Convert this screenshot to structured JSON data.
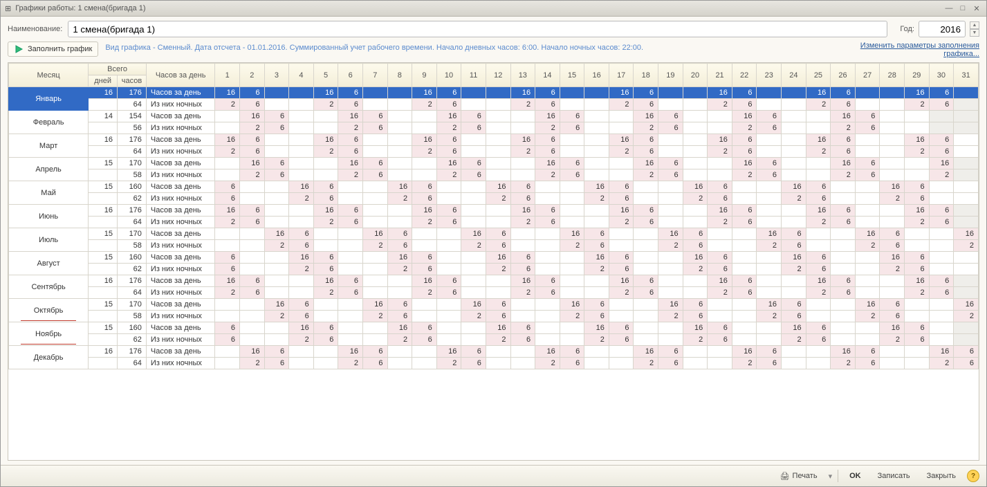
{
  "window_title": "Графики работы: 1 смена(бригада 1)",
  "labels": {
    "name": "Наименование:",
    "year": "Год:",
    "fill": "Заполнить график",
    "info": "Вид графика - Сменный. Дата отсчета - 01.01.2016. Суммированный учет рабочего времени. Начало дневных часов: 6:00. Начало ночных часов: 22:00.",
    "change": "Изменить параметры заполнения\nграфика...",
    "print": "Печать",
    "ok": "OK",
    "save": "Записать",
    "close": "Закрыть"
  },
  "fields": {
    "name_value": "1 смена(бригада 1)",
    "year_value": "2016"
  },
  "headers": {
    "month": "Месяц",
    "total": "Всего",
    "days": "дней",
    "hours": "часов",
    "perday": "Часов за день",
    "row_h": "Часов за день",
    "row_n": "Из них ночных"
  },
  "underlined_months": [
    "Октябрь",
    "Ноябрь"
  ],
  "months": [
    {
      "name": "Январь",
      "days": 16,
      "hours": 176,
      "night": 64,
      "h": {
        "1": 16,
        "2": 6,
        "5": 16,
        "6": 6,
        "9": 16,
        "10": 6,
        "13": 16,
        "14": 6,
        "17": 16,
        "18": 6,
        "21": 16,
        "22": 6,
        "25": 16,
        "26": 6,
        "29": 16,
        "30": 6
      },
      "n": {
        "1": 2,
        "2": 6,
        "5": 2,
        "6": 6,
        "9": 2,
        "10": 6,
        "13": 2,
        "14": 6,
        "17": 2,
        "18": 6,
        "21": 2,
        "22": 6,
        "25": 2,
        "26": 6,
        "29": 2,
        "30": 6
      },
      "weekend": [
        31
      ]
    },
    {
      "name": "Февраль",
      "days": 14,
      "hours": 154,
      "night": 56,
      "h": {
        "2": 16,
        "3": 6,
        "6": 16,
        "7": 6,
        "10": 16,
        "11": 6,
        "14": 16,
        "15": 6,
        "18": 16,
        "19": 6,
        "22": 16,
        "23": 6,
        "26": 16,
        "27": 6
      },
      "n": {
        "2": 2,
        "3": 6,
        "6": 2,
        "7": 6,
        "10": 2,
        "11": 6,
        "14": 2,
        "15": 6,
        "18": 2,
        "19": 6,
        "22": 2,
        "23": 6,
        "26": 2,
        "27": 6
      },
      "weekend": [
        30,
        31
      ]
    },
    {
      "name": "Март",
      "days": 16,
      "hours": 176,
      "night": 64,
      "h": {
        "1": 16,
        "2": 6,
        "5": 16,
        "6": 6,
        "9": 16,
        "10": 6,
        "13": 16,
        "14": 6,
        "17": 16,
        "18": 6,
        "21": 16,
        "22": 6,
        "25": 16,
        "26": 6,
        "29": 16,
        "30": 6
      },
      "n": {
        "1": 2,
        "2": 6,
        "5": 2,
        "6": 6,
        "9": 2,
        "10": 6,
        "13": 2,
        "14": 6,
        "17": 2,
        "18": 6,
        "21": 2,
        "22": 6,
        "25": 2,
        "26": 6,
        "29": 2,
        "30": 6
      },
      "weekend": []
    },
    {
      "name": "Апрель",
      "days": 15,
      "hours": 170,
      "night": 58,
      "h": {
        "2": 16,
        "3": 6,
        "6": 16,
        "7": 6,
        "10": 16,
        "11": 6,
        "14": 16,
        "15": 6,
        "18": 16,
        "19": 6,
        "22": 16,
        "23": 6,
        "26": 16,
        "27": 6,
        "30": 16
      },
      "n": {
        "2": 2,
        "3": 6,
        "6": 2,
        "7": 6,
        "10": 2,
        "11": 6,
        "14": 2,
        "15": 6,
        "18": 2,
        "19": 6,
        "22": 2,
        "23": 6,
        "26": 2,
        "27": 6,
        "30": 2
      },
      "weekend": [
        31
      ]
    },
    {
      "name": "Май",
      "days": 15,
      "hours": 160,
      "night": 62,
      "h": {
        "1": 6,
        "4": 16,
        "5": 6,
        "8": 16,
        "9": 6,
        "12": 16,
        "13": 6,
        "16": 16,
        "17": 6,
        "20": 16,
        "21": 6,
        "24": 16,
        "25": 6,
        "28": 16,
        "29": 6
      },
      "n": {
        "1": 6,
        "4": 2,
        "5": 6,
        "8": 2,
        "9": 6,
        "12": 2,
        "13": 6,
        "16": 2,
        "17": 6,
        "20": 2,
        "21": 6,
        "24": 2,
        "25": 6,
        "28": 2,
        "29": 6
      },
      "weekend": []
    },
    {
      "name": "Июнь",
      "days": 16,
      "hours": 176,
      "night": 64,
      "h": {
        "1": 16,
        "2": 6,
        "5": 16,
        "6": 6,
        "9": 16,
        "10": 6,
        "13": 16,
        "14": 6,
        "17": 16,
        "18": 6,
        "21": 16,
        "22": 6,
        "25": 16,
        "26": 6,
        "29": 16,
        "30": 6
      },
      "n": {
        "1": 2,
        "2": 6,
        "5": 2,
        "6": 6,
        "9": 2,
        "10": 6,
        "13": 2,
        "14": 6,
        "17": 2,
        "18": 6,
        "21": 2,
        "22": 6,
        "25": 2,
        "26": 6,
        "29": 2,
        "30": 6
      },
      "weekend": [
        31
      ]
    },
    {
      "name": "Июль",
      "days": 15,
      "hours": 170,
      "night": 58,
      "h": {
        "3": 16,
        "4": 6,
        "7": 16,
        "8": 6,
        "11": 16,
        "12": 6,
        "15": 16,
        "16": 6,
        "19": 16,
        "20": 6,
        "23": 16,
        "24": 6,
        "27": 16,
        "28": 6,
        "31": 16
      },
      "n": {
        "3": 2,
        "4": 6,
        "7": 2,
        "8": 6,
        "11": 2,
        "12": 6,
        "15": 2,
        "16": 6,
        "19": 2,
        "20": 6,
        "23": 2,
        "24": 6,
        "27": 2,
        "28": 6,
        "31": 2
      },
      "weekend": []
    },
    {
      "name": "Август",
      "days": 15,
      "hours": 160,
      "night": 62,
      "h": {
        "1": 6,
        "4": 16,
        "5": 6,
        "8": 16,
        "9": 6,
        "12": 16,
        "13": 6,
        "16": 16,
        "17": 6,
        "20": 16,
        "21": 6,
        "24": 16,
        "25": 6,
        "28": 16,
        "29": 6
      },
      "n": {
        "1": 6,
        "4": 2,
        "5": 6,
        "8": 2,
        "9": 6,
        "12": 2,
        "13": 6,
        "16": 2,
        "17": 6,
        "20": 2,
        "21": 6,
        "24": 2,
        "25": 6,
        "28": 2,
        "29": 6
      },
      "weekend": []
    },
    {
      "name": "Сентябрь",
      "days": 16,
      "hours": 176,
      "night": 64,
      "h": {
        "1": 16,
        "2": 6,
        "5": 16,
        "6": 6,
        "9": 16,
        "10": 6,
        "13": 16,
        "14": 6,
        "17": 16,
        "18": 6,
        "21": 16,
        "22": 6,
        "25": 16,
        "26": 6,
        "29": 16,
        "30": 6
      },
      "n": {
        "1": 2,
        "2": 6,
        "5": 2,
        "6": 6,
        "9": 2,
        "10": 6,
        "13": 2,
        "14": 6,
        "17": 2,
        "18": 6,
        "21": 2,
        "22": 6,
        "25": 2,
        "26": 6,
        "29": 2,
        "30": 6
      },
      "weekend": [
        31
      ]
    },
    {
      "name": "Октябрь",
      "days": 15,
      "hours": 170,
      "night": 58,
      "h": {
        "3": 16,
        "4": 6,
        "7": 16,
        "8": 6,
        "11": 16,
        "12": 6,
        "15": 16,
        "16": 6,
        "19": 16,
        "20": 6,
        "23": 16,
        "24": 6,
        "27": 16,
        "28": 6,
        "31": 16
      },
      "n": {
        "3": 2,
        "4": 6,
        "7": 2,
        "8": 6,
        "11": 2,
        "12": 6,
        "15": 2,
        "16": 6,
        "19": 2,
        "20": 6,
        "23": 2,
        "24": 6,
        "27": 2,
        "28": 6,
        "31": 2
      },
      "weekend": []
    },
    {
      "name": "Ноябрь",
      "days": 15,
      "hours": 160,
      "night": 62,
      "h": {
        "1": 6,
        "4": 16,
        "5": 6,
        "8": 16,
        "9": 6,
        "12": 16,
        "13": 6,
        "16": 16,
        "17": 6,
        "20": 16,
        "21": 6,
        "24": 16,
        "25": 6,
        "28": 16,
        "29": 6
      },
      "n": {
        "1": 6,
        "4": 2,
        "5": 6,
        "8": 2,
        "9": 6,
        "12": 2,
        "13": 6,
        "16": 2,
        "17": 6,
        "20": 2,
        "21": 6,
        "24": 2,
        "25": 6,
        "28": 2,
        "29": 6
      },
      "weekend": [
        31
      ]
    },
    {
      "name": "Декабрь",
      "days": 16,
      "hours": 176,
      "night": 64,
      "h": {
        "2": 16,
        "3": 6,
        "6": 16,
        "7": 6,
        "10": 16,
        "11": 6,
        "14": 16,
        "15": 6,
        "18": 16,
        "19": 6,
        "22": 16,
        "23": 6,
        "26": 16,
        "27": 6,
        "30": 16,
        "31": 6
      },
      "n": {
        "2": 2,
        "3": 6,
        "6": 2,
        "7": 6,
        "10": 2,
        "11": 6,
        "14": 2,
        "15": 6,
        "18": 2,
        "19": 6,
        "22": 2,
        "23": 6,
        "26": 2,
        "27": 6,
        "30": 2,
        "31": 6
      },
      "weekend": []
    }
  ]
}
